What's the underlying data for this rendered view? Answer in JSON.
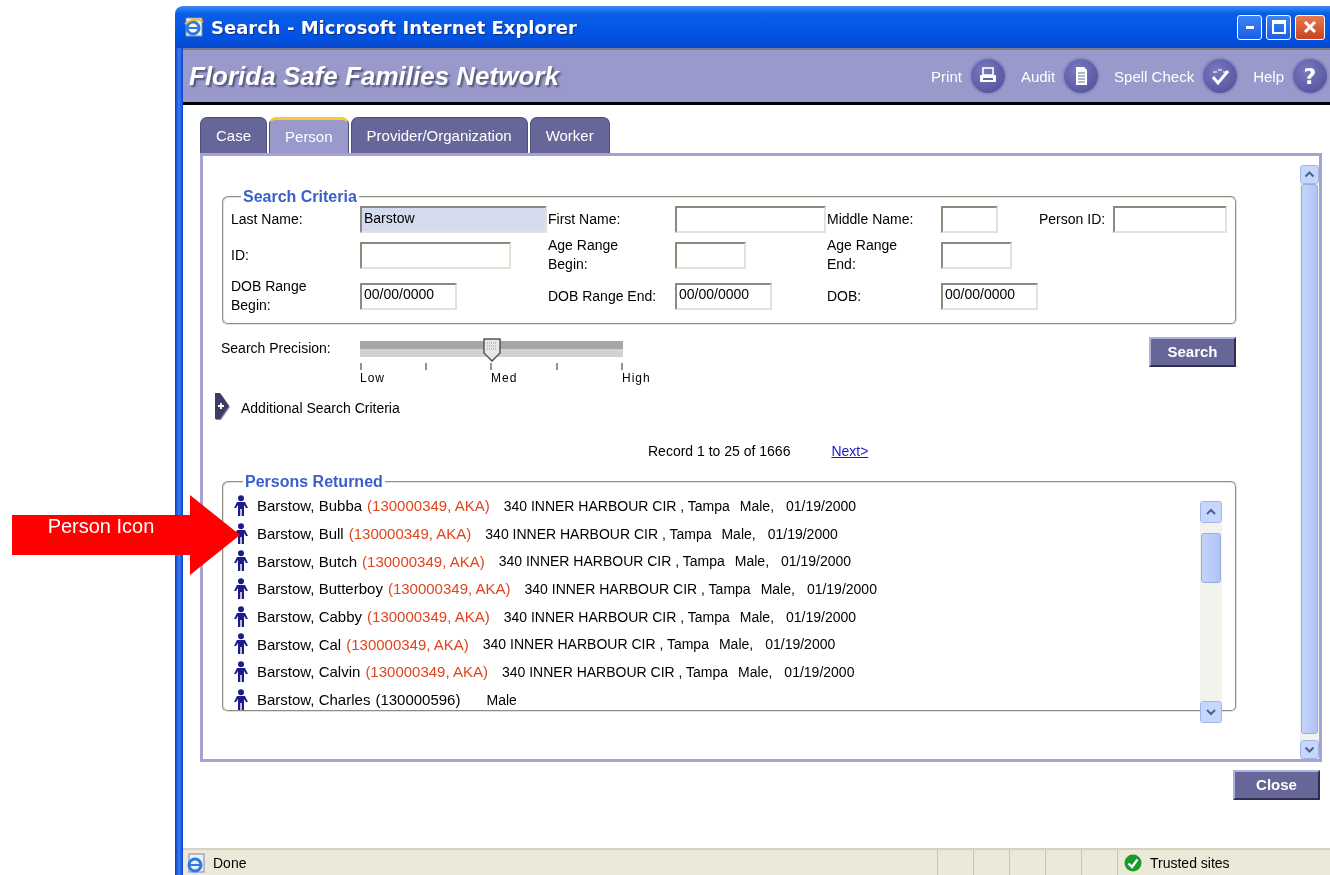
{
  "annotation": {
    "text": "Person Icon"
  },
  "window": {
    "title": "Search - Microsoft Internet Explorer"
  },
  "header": {
    "title": "Florida Safe Families Network",
    "tools": [
      {
        "label": "Print",
        "kind": "print"
      },
      {
        "label": "Audit",
        "kind": "audit"
      },
      {
        "label": "Spell Check",
        "kind": "spell"
      },
      {
        "label": "Help",
        "kind": "help",
        "glyph": "?"
      }
    ]
  },
  "tabs": [
    {
      "label": "Case",
      "selected": false
    },
    {
      "label": "Person",
      "selected": true
    },
    {
      "label": "Provider/Organization",
      "selected": false
    },
    {
      "label": "Worker",
      "selected": false
    }
  ],
  "search_criteria": {
    "title": "Search Criteria",
    "rows": [
      [
        {
          "label": "Last Name:",
          "value": "Barstow",
          "kind": "long",
          "highlighted": true
        },
        {
          "label": "First Name:",
          "kind": "medium",
          "highlighted": false
        },
        {
          "label": "Middle Name:",
          "kind": "small",
          "highlighted": false
        },
        {
          "label": "Person ID:",
          "kind": "id",
          "highlighted": false
        }
      ],
      [
        {
          "label": "ID:",
          "kind": "medium",
          "highlighted": false
        },
        {
          "label": "Age Range\nBegin:",
          "kind": "short",
          "highlighted": false
        },
        {
          "label": "Age Range\nEnd:",
          "kind": "short",
          "highlighted": false
        }
      ],
      [
        {
          "label": "DOB Range\nBegin:",
          "value": "00/00/0000",
          "kind": "date",
          "highlighted": false
        },
        {
          "label": "DOB Range End:",
          "value": "00/00/0000",
          "kind": "date",
          "highlighted": false
        },
        {
          "label": "DOB:",
          "value": "00/00/0000",
          "kind": "date",
          "highlighted": false
        }
      ]
    ]
  },
  "precision": {
    "label": "Search Precision:",
    "level": 0.5,
    "scale": [
      "Low",
      "Med",
      "High"
    ]
  },
  "search_button": "Search",
  "additional_criteria": {
    "label": "Additional Search Criteria",
    "expanded": false
  },
  "paging": {
    "summary": "Record 1 to 25 of 1666",
    "next": "Next>"
  },
  "results": {
    "title": "Persons Returned",
    "rows": [
      {
        "name": "Barstow, Bubba",
        "ids": "(130000349, AKA)",
        "aka": true,
        "address": "340 INNER HARBOUR CIR , Tampa",
        "sex": "Male,",
        "dob": "01/19/2000"
      },
      {
        "name": "Barstow, Bull",
        "ids": "(130000349, AKA)",
        "aka": true,
        "address": "340 INNER HARBOUR CIR , Tampa",
        "sex": "Male,",
        "dob": "01/19/2000"
      },
      {
        "name": "Barstow, Butch",
        "ids": "(130000349, AKA)",
        "aka": true,
        "address": "340 INNER HARBOUR CIR , Tampa",
        "sex": "Male,",
        "dob": "01/19/2000"
      },
      {
        "name": "Barstow, Butterboy",
        "ids": "(130000349, AKA)",
        "aka": true,
        "address": "340 INNER HARBOUR CIR , Tampa",
        "sex": "Male,",
        "dob": "01/19/2000"
      },
      {
        "name": "Barstow, Cabby",
        "ids": "(130000349, AKA)",
        "aka": true,
        "address": "340 INNER HARBOUR CIR , Tampa",
        "sex": "Male,",
        "dob": "01/19/2000"
      },
      {
        "name": "Barstow, Cal",
        "ids": "(130000349, AKA)",
        "aka": true,
        "address": "340 INNER HARBOUR CIR , Tampa",
        "sex": "Male,",
        "dob": "01/19/2000"
      },
      {
        "name": "Barstow, Calvin",
        "ids": "(130000349, AKA)",
        "aka": true,
        "address": "340 INNER HARBOUR CIR , Tampa",
        "sex": "Male,",
        "dob": "01/19/2000"
      },
      {
        "name": "Barstow, Charles",
        "ids": "(130000596)",
        "aka": false,
        "sex": "Male"
      }
    ]
  },
  "close_button": "Close",
  "status_bar": {
    "text": "Done",
    "zone": "Trusted sites"
  }
}
